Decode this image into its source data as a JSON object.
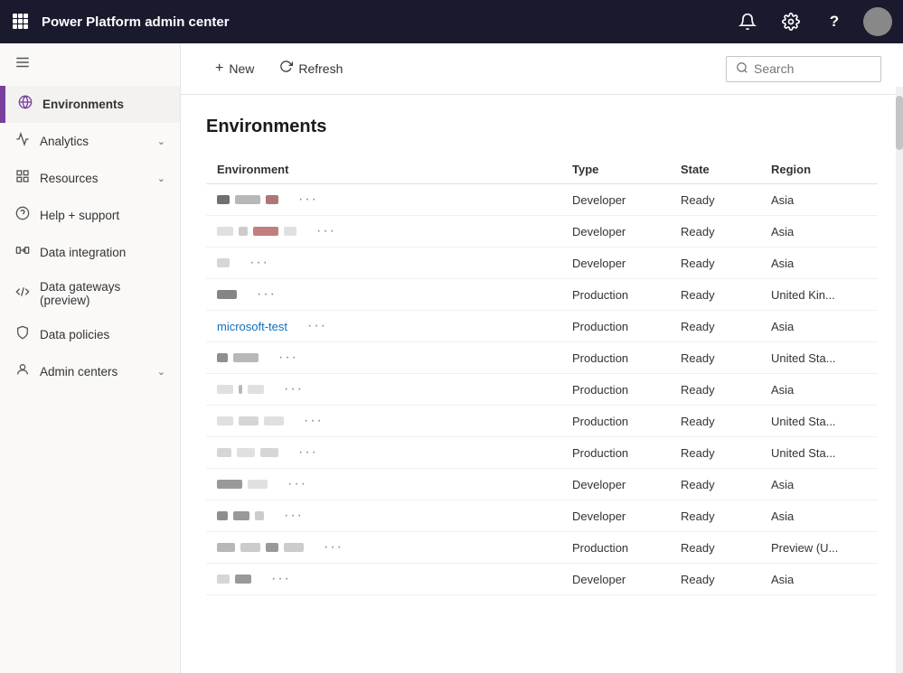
{
  "topbar": {
    "title": "Power Platform admin center",
    "grid_icon": "⊞",
    "bell_icon": "🔔",
    "gear_icon": "⚙",
    "help_icon": "?",
    "avatar_initials": ""
  },
  "sidebar": {
    "hamburger_icon": "☰",
    "items": [
      {
        "id": "environments",
        "label": "Environments",
        "icon": "🌐",
        "active": true,
        "chevron": false
      },
      {
        "id": "analytics",
        "label": "Analytics",
        "icon": "↗",
        "active": false,
        "chevron": true
      },
      {
        "id": "resources",
        "label": "Resources",
        "icon": "🗂",
        "active": false,
        "chevron": true
      },
      {
        "id": "help-support",
        "label": "Help + support",
        "icon": "🎧",
        "active": false,
        "chevron": false
      },
      {
        "id": "data-integration",
        "label": "Data integration",
        "icon": "🔄",
        "active": false,
        "chevron": false
      },
      {
        "id": "data-gateways",
        "label": "Data gateways (preview)",
        "icon": "☁",
        "active": false,
        "chevron": false
      },
      {
        "id": "data-policies",
        "label": "Data policies",
        "icon": "🛡",
        "active": false,
        "chevron": false
      },
      {
        "id": "admin-centers",
        "label": "Admin centers",
        "icon": "🅰",
        "active": false,
        "chevron": true
      }
    ]
  },
  "toolbar": {
    "new_label": "New",
    "new_icon": "+",
    "refresh_label": "Refresh",
    "refresh_icon": "↺",
    "search_placeholder": "Search"
  },
  "page": {
    "title": "Environments",
    "table": {
      "columns": [
        "Environment",
        "Type",
        "State",
        "Region"
      ],
      "rows": [
        {
          "name_blocks": [
            14,
            28,
            14
          ],
          "name_colors": [
            "#111",
            "#888",
            "#7a1a1a"
          ],
          "name_text": "",
          "type": "Developer",
          "state": "Ready",
          "region": "Asia"
        },
        {
          "name_blocks": [
            18,
            10,
            28,
            14
          ],
          "name_colors": [
            "#ccc",
            "#aaa",
            "#9a2a2a",
            "#ccc"
          ],
          "name_text": "",
          "type": "Developer",
          "state": "Ready",
          "region": "Asia"
        },
        {
          "name_blocks": [
            14
          ],
          "name_colors": [
            "#bbb"
          ],
          "name_text": "",
          "type": "Developer",
          "state": "Ready",
          "region": "Asia"
        },
        {
          "name_blocks": [
            22
          ],
          "name_colors": [
            "#333"
          ],
          "name_text": "",
          "type": "Production",
          "state": "Ready",
          "region": "United Kin..."
        },
        {
          "name_blocks": [],
          "name_text": "microsoft-test",
          "type": "Production",
          "state": "Ready",
          "region": "Asia"
        },
        {
          "name_blocks": [
            12,
            28
          ],
          "name_colors": [
            "#444",
            "#888"
          ],
          "name_text": "",
          "type": "Production",
          "state": "Ready",
          "region": "United Sta..."
        },
        {
          "name_blocks": [
            18,
            4,
            18
          ],
          "name_colors": [
            "#ccc",
            "#888",
            "#ccc"
          ],
          "name_text": "",
          "type": "Production",
          "state": "Ready",
          "region": "Asia"
        },
        {
          "name_blocks": [
            18,
            22,
            22
          ],
          "name_colors": [
            "#ccc",
            "#bbb",
            "#ccc"
          ],
          "name_text": "",
          "type": "Production",
          "state": "Ready",
          "region": "United Sta..."
        },
        {
          "name_blocks": [
            16,
            20,
            20
          ],
          "name_colors": [
            "#bbb",
            "#ccc",
            "#bbb"
          ],
          "name_text": "",
          "type": "Production",
          "state": "Ready",
          "region": "United Sta..."
        },
        {
          "name_blocks": [
            28,
            22
          ],
          "name_colors": [
            "#555",
            "#ccc"
          ],
          "name_text": "",
          "type": "Developer",
          "state": "Ready",
          "region": "Asia"
        },
        {
          "name_blocks": [
            12,
            18,
            10
          ],
          "name_colors": [
            "#444",
            "#555",
            "#aaa"
          ],
          "name_text": "",
          "type": "Developer",
          "state": "Ready",
          "region": "Asia"
        },
        {
          "name_blocks": [
            20,
            22,
            14,
            22
          ],
          "name_colors": [
            "#888",
            "#aaa",
            "#555",
            "#aaa"
          ],
          "name_text": "",
          "type": "Production",
          "state": "Ready",
          "region": "Preview (U..."
        },
        {
          "name_blocks": [
            14,
            18
          ],
          "name_colors": [
            "#bbb",
            "#555"
          ],
          "name_text": "",
          "type": "Developer",
          "state": "Ready",
          "region": "Asia"
        }
      ]
    }
  }
}
